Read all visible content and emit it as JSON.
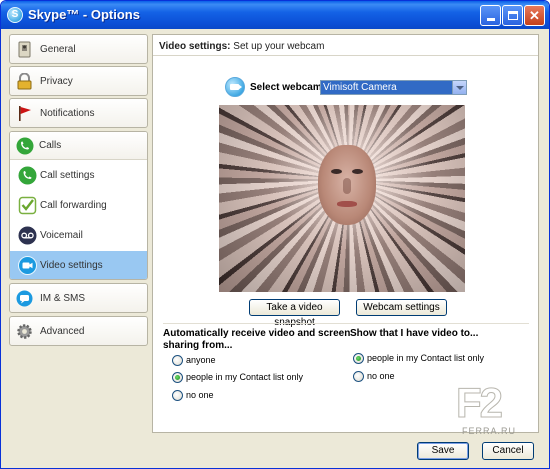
{
  "window": {
    "title": "Skype™ - Options",
    "app_icon_letter": "S"
  },
  "sidebar": {
    "items": [
      {
        "label": "General",
        "icon": "general-icon"
      },
      {
        "label": "Privacy",
        "icon": "padlock-icon"
      },
      {
        "label": "Notifications",
        "icon": "flag-icon"
      },
      {
        "label": "Calls",
        "icon": "phone-icon"
      },
      {
        "label": "IM & SMS",
        "icon": "chat-icon"
      },
      {
        "label": "Advanced",
        "icon": "gear-icon"
      }
    ],
    "calls_sub": [
      {
        "label": "Call settings",
        "icon": "phone-icon"
      },
      {
        "label": "Call forwarding",
        "icon": "forward-icon"
      },
      {
        "label": "Voicemail",
        "icon": "voicemail-icon"
      },
      {
        "label": "Video settings",
        "icon": "video-icon",
        "active": true
      }
    ]
  },
  "panel": {
    "title_bold": "Video settings:",
    "title_rest": "Set up your webcam",
    "select_label": "Select webcam:",
    "webcam_value": "Vimisoft Camera",
    "snapshot_button": "Take a video snapshot",
    "webcam_settings_button": "Webcam settings",
    "receive": {
      "title": "Automatically receive video and screen sharing from...",
      "options": [
        "anyone",
        "people in my Contact list only",
        "no one"
      ],
      "selected": 1
    },
    "show": {
      "title": "Show that I have video to...",
      "options": [
        "people in my Contact list only",
        "no one"
      ],
      "selected": 0
    }
  },
  "footer": {
    "save": "Save",
    "cancel": "Cancel"
  },
  "watermark": {
    "letters": "F2",
    "site": "FERRA.RU"
  },
  "colors": {
    "accent": "#316ac5",
    "active_nav": "#99c8f2",
    "title_bar": "#0b4fd6"
  }
}
